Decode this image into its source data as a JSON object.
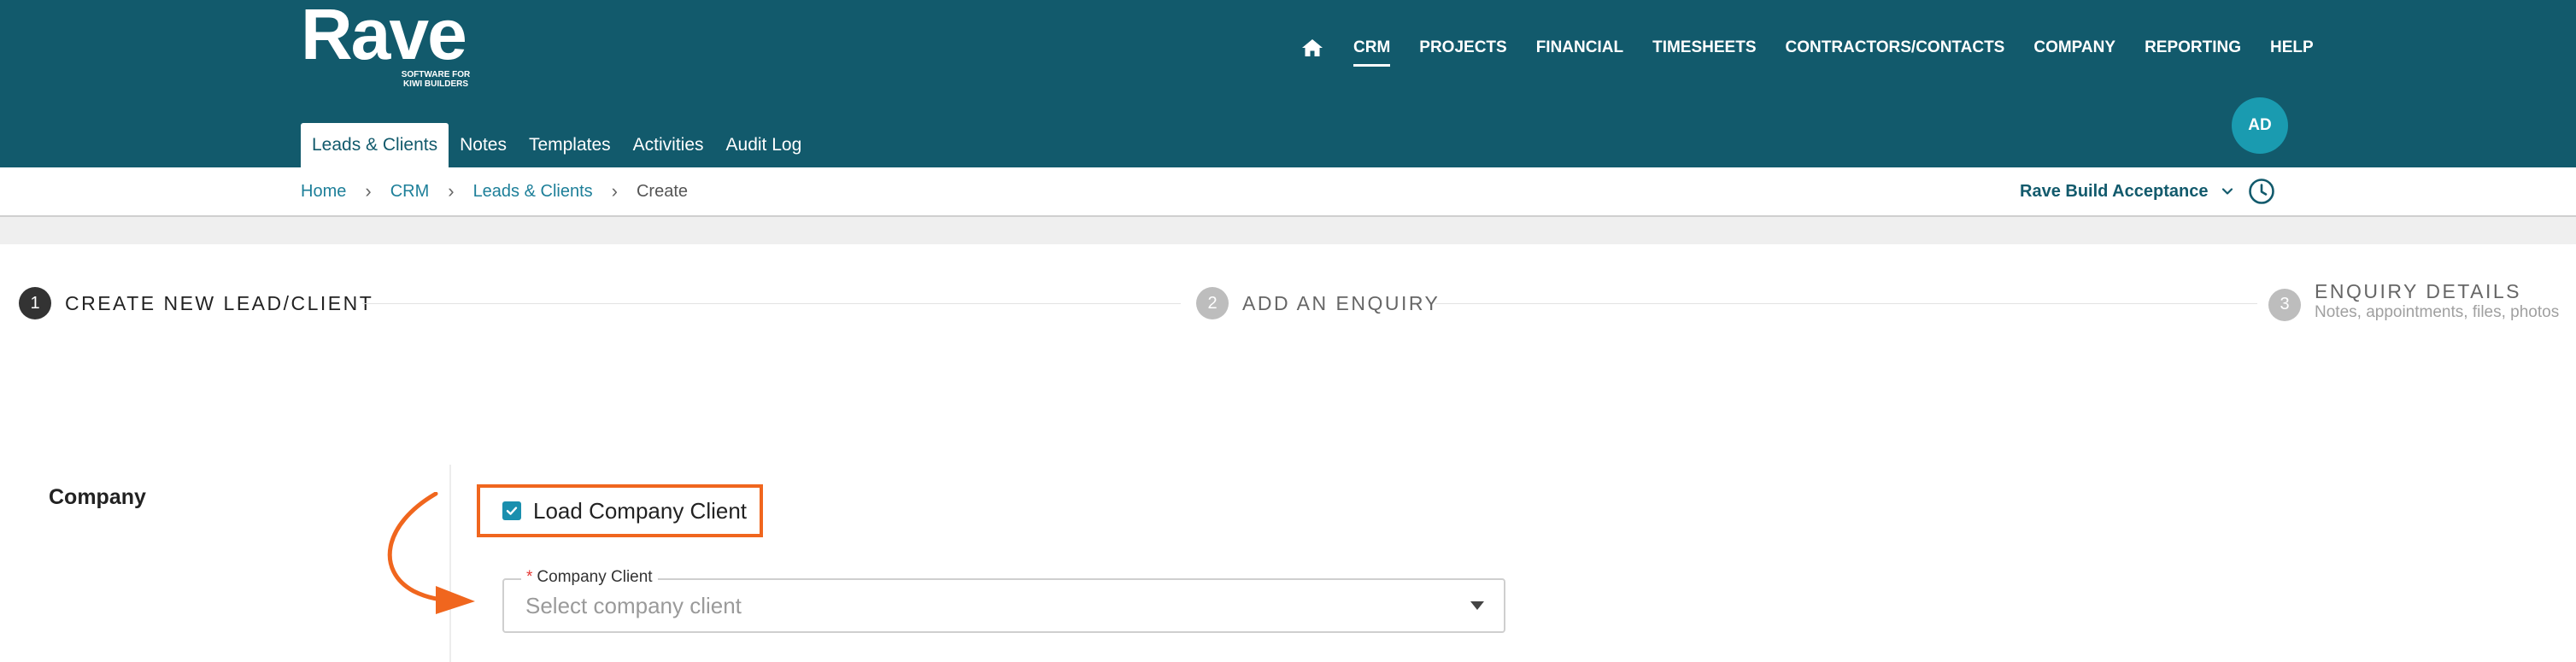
{
  "brand": {
    "name": "Rave",
    "tagline_line1": "SOFTWARE FOR",
    "tagline_line2": "KIWI BUILDERS"
  },
  "topnav": {
    "home_icon": "home-icon",
    "items": [
      {
        "label": "CRM",
        "active": true
      },
      {
        "label": "PROJECTS",
        "active": false
      },
      {
        "label": "FINANCIAL",
        "active": false
      },
      {
        "label": "TIMESHEETS",
        "active": false
      },
      {
        "label": "CONTRACTORS/CONTACTS",
        "active": false
      },
      {
        "label": "COMPANY",
        "active": false
      },
      {
        "label": "REPORTING",
        "active": false
      },
      {
        "label": "HELP",
        "active": false
      }
    ]
  },
  "subnav": {
    "tabs": [
      {
        "label": "Leads & Clients",
        "active": true
      },
      {
        "label": "Notes",
        "active": false
      },
      {
        "label": "Templates",
        "active": false
      },
      {
        "label": "Activities",
        "active": false
      },
      {
        "label": "Audit Log",
        "active": false
      }
    ]
  },
  "user": {
    "initials": "AD"
  },
  "breadcrumb": {
    "items": [
      "Home",
      "CRM",
      "Leads & Clients",
      "Create"
    ],
    "separator": "›"
  },
  "workspace": {
    "name": "Rave Build Acceptance",
    "icon": "chevron-down-icon"
  },
  "history_icon": "clock-icon",
  "stepper": {
    "steps": [
      {
        "number": "1",
        "title": "CREATE NEW LEAD/CLIENT",
        "description": "",
        "active": true
      },
      {
        "number": "2",
        "title": "ADD AN ENQUIRY",
        "description": "",
        "active": false
      },
      {
        "number": "3",
        "title": "ENQUIRY DETAILS",
        "description": "Notes, appointments, files, photos",
        "active": false
      }
    ]
  },
  "form": {
    "section_label": "Company",
    "load_company_client": {
      "label": "Load Company Client",
      "checked": true
    },
    "company_client": {
      "required_mark": "*",
      "label": "Company Client",
      "placeholder": "Select company client",
      "icon": "caret-down-icon"
    }
  },
  "colors": {
    "header_bg": "#125a6c",
    "accent": "#1a8fae",
    "highlight": "#f0661e",
    "link": "#1d7f99"
  }
}
